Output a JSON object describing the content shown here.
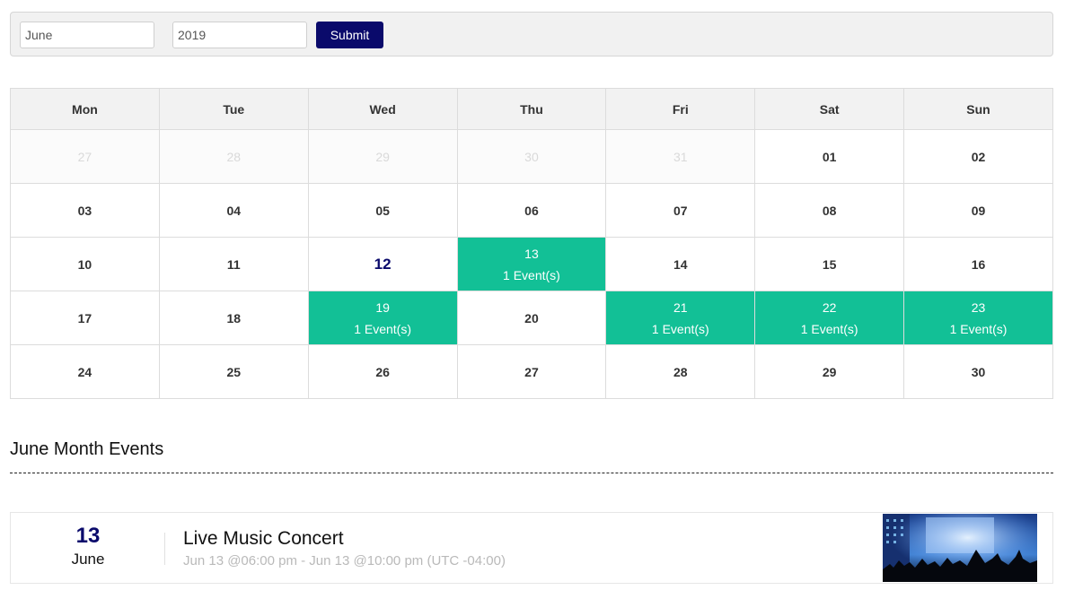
{
  "filter": {
    "month_value": "June",
    "year_value": "2019",
    "submit_label": "Submit"
  },
  "calendar": {
    "weekdays": [
      "Mon",
      "Tue",
      "Wed",
      "Thu",
      "Fri",
      "Sat",
      "Sun"
    ],
    "weeks": [
      [
        {
          "day": "27",
          "state": "muted"
        },
        {
          "day": "28",
          "state": "muted"
        },
        {
          "day": "29",
          "state": "muted"
        },
        {
          "day": "30",
          "state": "muted"
        },
        {
          "day": "31",
          "state": "muted"
        },
        {
          "day": "01",
          "state": "normal"
        },
        {
          "day": "02",
          "state": "normal"
        }
      ],
      [
        {
          "day": "03",
          "state": "normal"
        },
        {
          "day": "04",
          "state": "normal"
        },
        {
          "day": "05",
          "state": "normal"
        },
        {
          "day": "06",
          "state": "normal"
        },
        {
          "day": "07",
          "state": "normal"
        },
        {
          "day": "08",
          "state": "normal"
        },
        {
          "day": "09",
          "state": "normal"
        }
      ],
      [
        {
          "day": "10",
          "state": "normal"
        },
        {
          "day": "11",
          "state": "normal"
        },
        {
          "day": "12",
          "state": "today"
        },
        {
          "day": "13",
          "state": "event",
          "events": "1 Event(s)"
        },
        {
          "day": "14",
          "state": "normal"
        },
        {
          "day": "15",
          "state": "normal"
        },
        {
          "day": "16",
          "state": "normal"
        }
      ],
      [
        {
          "day": "17",
          "state": "normal"
        },
        {
          "day": "18",
          "state": "normal"
        },
        {
          "day": "19",
          "state": "event",
          "events": "1 Event(s)"
        },
        {
          "day": "20",
          "state": "normal"
        },
        {
          "day": "21",
          "state": "event",
          "events": "1 Event(s)"
        },
        {
          "day": "22",
          "state": "event",
          "events": "1 Event(s)"
        },
        {
          "day": "23",
          "state": "event",
          "events": "1 Event(s)"
        }
      ],
      [
        {
          "day": "24",
          "state": "normal"
        },
        {
          "day": "25",
          "state": "normal"
        },
        {
          "day": "26",
          "state": "normal"
        },
        {
          "day": "27",
          "state": "normal"
        },
        {
          "day": "28",
          "state": "normal"
        },
        {
          "day": "29",
          "state": "normal"
        },
        {
          "day": "30",
          "state": "normal"
        }
      ]
    ]
  },
  "events_section": {
    "title": "June Month Events",
    "events": [
      {
        "day": "13",
        "month": "June",
        "title": "Live Music Concert",
        "time": "Jun 13 @06:00 pm - Jun 13 @10:00 pm (UTC -04:00)",
        "image_icon": "concert-photo"
      }
    ]
  },
  "colors": {
    "accent_navy": "#0a0a6b",
    "event_green": "#12c096",
    "header_gray": "#f2f2f2"
  }
}
